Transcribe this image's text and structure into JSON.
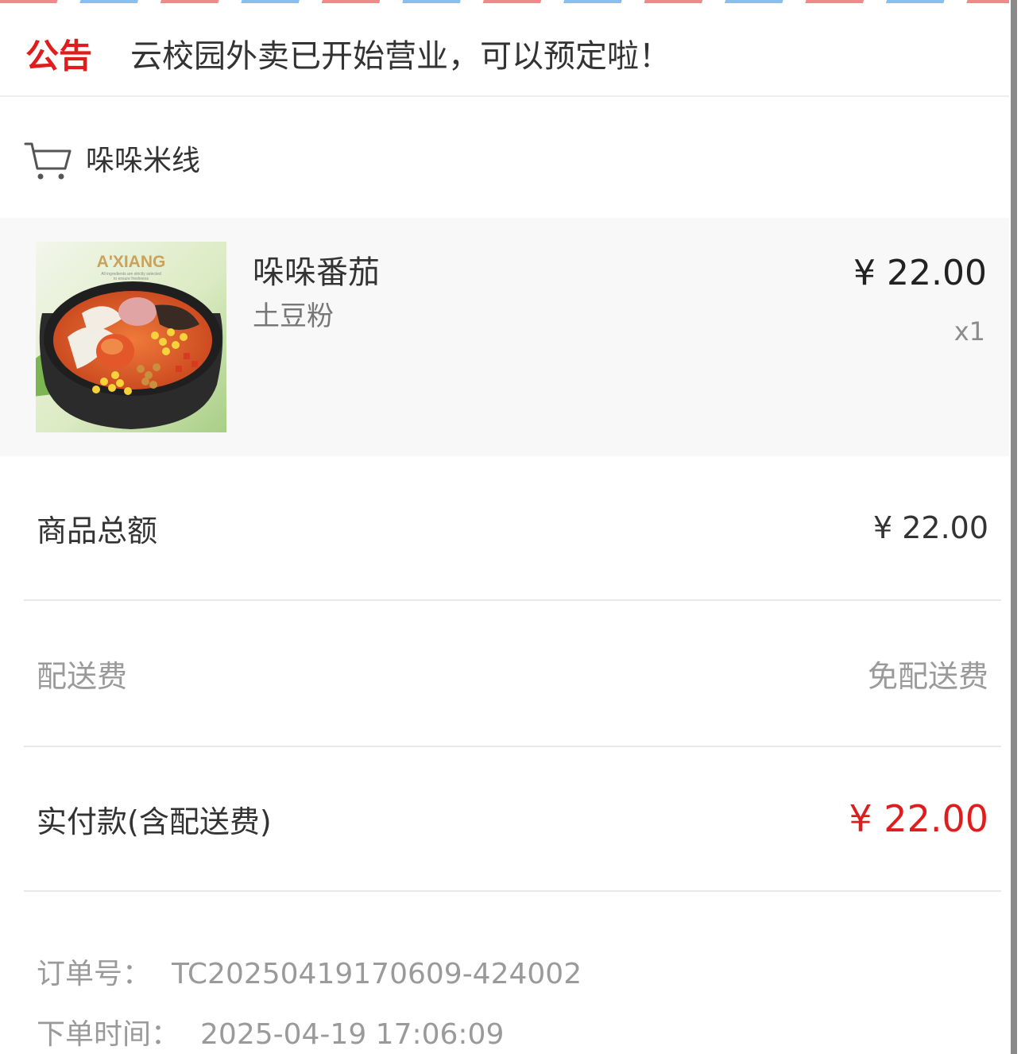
{
  "notice": {
    "label": "公告",
    "text": "云校园外卖已开始营业，可以预定啦！"
  },
  "shop": {
    "name": "哚哚米线",
    "icon": "cart-icon"
  },
  "item": {
    "image_brand": "A'XIANG",
    "image_tagline_1": "All ingredients are strictly selected",
    "image_tagline_2": "to ensure freshness",
    "name": "哚哚番茄",
    "spec": "土豆粉",
    "price": "¥ 22.00",
    "quantity": "x1"
  },
  "summary": {
    "subtotal_label": "商品总额",
    "subtotal_value": "¥ 22.00",
    "delivery_label": "配送费",
    "delivery_value": "免配送费",
    "paid_label": "实付款(含配送费)",
    "paid_value": "¥ 22.00"
  },
  "order": {
    "number_label": "订单号：",
    "number_value": "TC20250419170609-424002",
    "time_label": "下单时间：",
    "time_value": "2025-04-19 17:06:09"
  },
  "colors": {
    "accent_red": "#e01d1d",
    "text_dark": "#333333",
    "text_muted": "#9a9a9a",
    "item_bg": "#f8f8f8",
    "divider": "#e8e8e8"
  }
}
